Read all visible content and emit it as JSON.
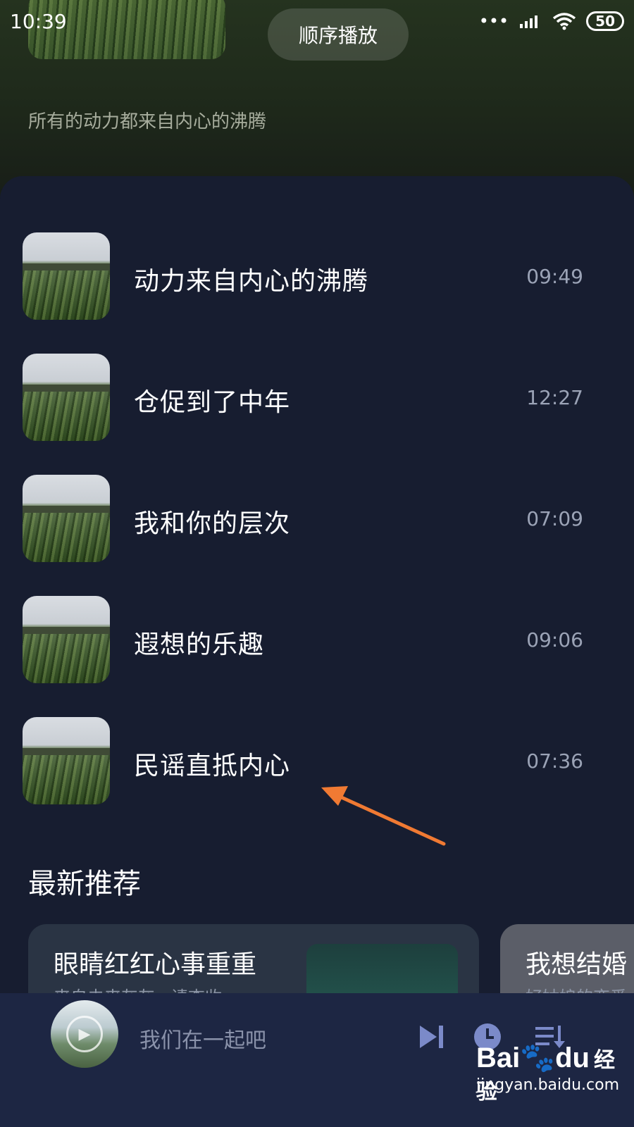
{
  "status_bar": {
    "time": "10:39",
    "battery": "50"
  },
  "header": {
    "play_mode": "顺序播放",
    "subtitle": "所有的动力都来自内心的沸腾"
  },
  "songs": [
    {
      "title": "动力来自内心的沸腾",
      "duration": "09:49"
    },
    {
      "title": "仓促到了中年",
      "duration": "12:27"
    },
    {
      "title": "我和你的层次",
      "duration": "07:09"
    },
    {
      "title": "遐想的乐趣",
      "duration": "09:06"
    },
    {
      "title": "民谣直抵内心",
      "duration": "07:36"
    }
  ],
  "recommend": {
    "section_title": "最新推荐",
    "cards": [
      {
        "title": "眼睛红红心事重重",
        "subtitle": "来自未来灰灰 · 请查收"
      },
      {
        "title": "我想结婚",
        "subtitle": "好姑娘的恋爱"
      }
    ]
  },
  "player": {
    "now_playing": "我们在一起吧"
  },
  "watermark": {
    "logo": "Bai",
    "logo_suffix": "du",
    "cn": "经验",
    "url": "jingyan.baidu.com"
  },
  "colors": {
    "panel_bg": "#171d30",
    "player_bg": "#1d2643",
    "accent_icon": "#7b8ac9",
    "annotation_arrow": "#f07a33"
  }
}
